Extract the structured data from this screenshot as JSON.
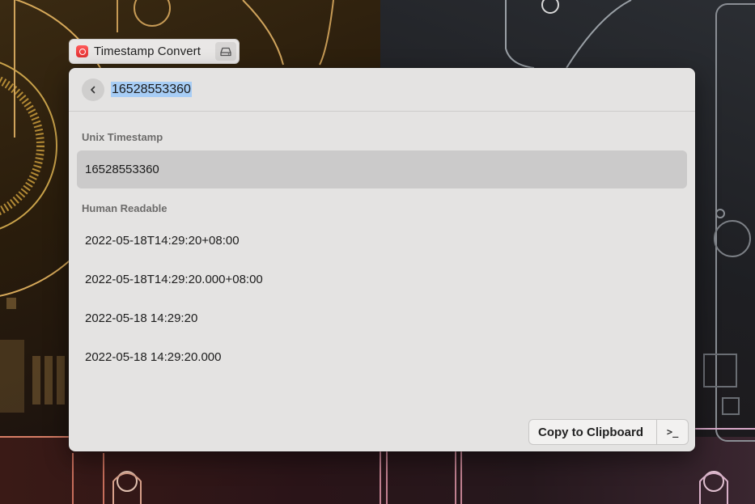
{
  "window": {
    "title": "Timestamp Convert"
  },
  "search": {
    "value": "16528553360"
  },
  "sections": [
    {
      "title": "Unix Timestamp",
      "items": [
        "16528553360"
      ]
    },
    {
      "title": "Human Readable",
      "items": [
        "2022-05-18T14:29:20+08:00",
        "2022-05-18T14:29:20.000+08:00",
        "2022-05-18 14:29:20",
        "2022-05-18 14:29:20.000"
      ]
    }
  ],
  "action": {
    "primary_label": "Copy to Clipboard",
    "secondary_label": ">_"
  },
  "icons": {
    "app": "timestamp-app-icon",
    "drive": "drive-icon",
    "back": "chevron-left-icon"
  },
  "colors": {
    "selection_highlight": "#a7cdf5",
    "selected_row": "#cbcaca",
    "app_icon": "#e33030"
  }
}
